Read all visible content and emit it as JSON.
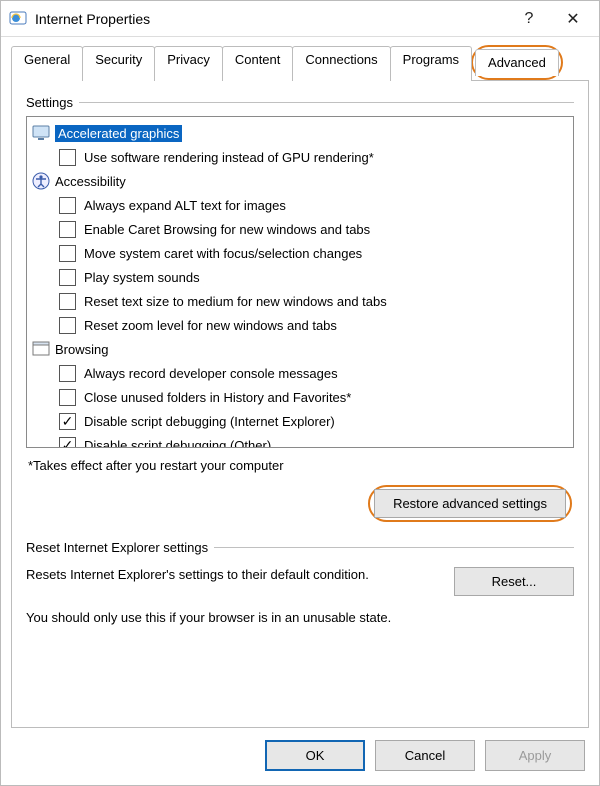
{
  "titlebar": {
    "title": "Internet Properties",
    "help_symbol": "?",
    "close_symbol": "✕"
  },
  "tabs": {
    "items": [
      {
        "label": "General"
      },
      {
        "label": "Security"
      },
      {
        "label": "Privacy"
      },
      {
        "label": "Content"
      },
      {
        "label": "Connections"
      },
      {
        "label": "Programs"
      },
      {
        "label": "Advanced"
      }
    ],
    "active_index": 6
  },
  "settings_group": {
    "title": "Settings",
    "categories": [
      {
        "icon": "monitor-icon",
        "label": "Accelerated graphics",
        "selected": true,
        "items": [
          {
            "label": "Use software rendering instead of GPU rendering*",
            "checked": false
          }
        ]
      },
      {
        "icon": "accessibility-icon",
        "label": "Accessibility",
        "selected": false,
        "items": [
          {
            "label": "Always expand ALT text for images",
            "checked": false
          },
          {
            "label": "Enable Caret Browsing for new windows and tabs",
            "checked": false
          },
          {
            "label": "Move system caret with focus/selection changes",
            "checked": false
          },
          {
            "label": "Play system sounds",
            "checked": false
          },
          {
            "label": "Reset text size to medium for new windows and tabs",
            "checked": false
          },
          {
            "label": "Reset zoom level for new windows and tabs",
            "checked": false
          }
        ]
      },
      {
        "icon": "window-icon",
        "label": "Browsing",
        "selected": false,
        "items": [
          {
            "label": "Always record developer console messages",
            "checked": false
          },
          {
            "label": "Close unused folders in History and Favorites*",
            "checked": false
          },
          {
            "label": "Disable script debugging (Internet Explorer)",
            "checked": true
          },
          {
            "label": "Disable script debugging (Other)",
            "checked": true
          }
        ]
      }
    ],
    "footnote": "*Takes effect after you restart your computer",
    "restore_button": "Restore advanced settings"
  },
  "reset_group": {
    "title": "Reset Internet Explorer settings",
    "description": "Resets Internet Explorer's settings to their default condition.",
    "button": "Reset...",
    "warning": "You should only use this if your browser is in an unusable state."
  },
  "buttons": {
    "ok": "OK",
    "cancel": "Cancel",
    "apply": "Apply"
  }
}
